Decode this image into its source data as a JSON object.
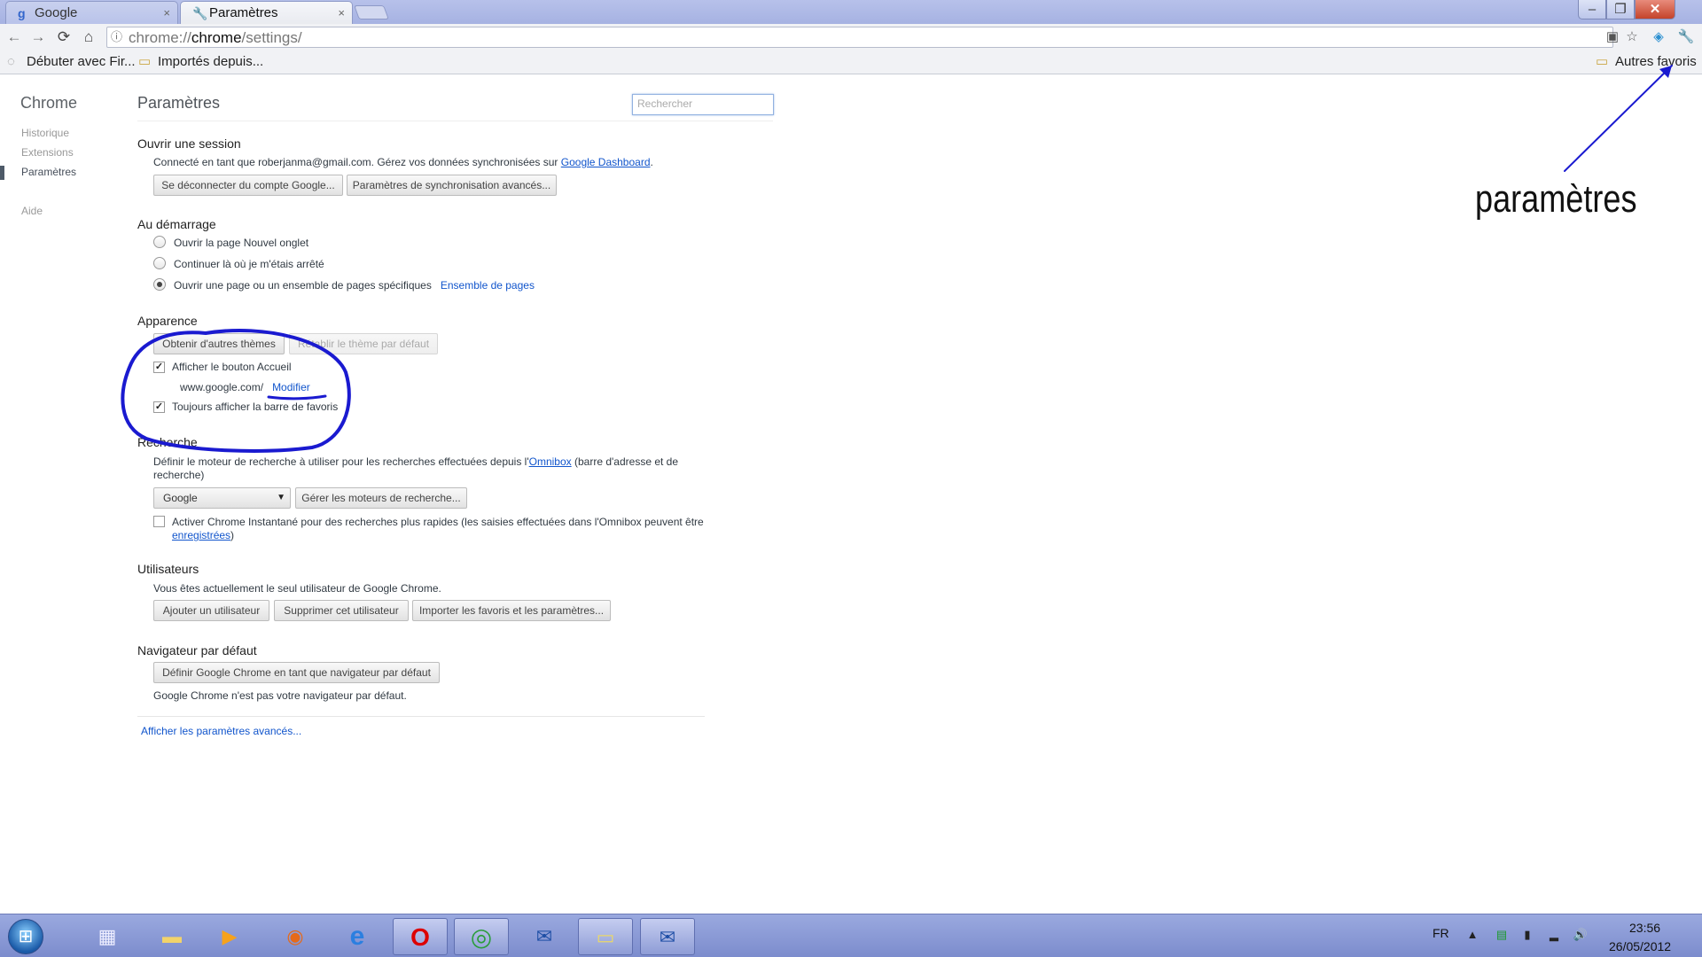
{
  "browser": {
    "tabs": [
      {
        "label": "Google",
        "favicon": "google-g-icon"
      },
      {
        "label": "Paramètres",
        "favicon": "wrench-icon"
      }
    ],
    "omnibox": {
      "scheme": "chrome://",
      "host": "chrome",
      "path": "/settings/"
    },
    "bookmarks": [
      {
        "label": "Débuter avec Fir...",
        "icon": "page-icon"
      },
      {
        "label": "Importés depuis...",
        "icon": "folder-icon"
      }
    ],
    "other_bookmarks": "Autres favoris"
  },
  "sidebar": {
    "title": "Chrome",
    "items": [
      {
        "label": "Historique"
      },
      {
        "label": "Extensions"
      },
      {
        "label": "Paramètres"
      },
      {
        "label": "Aide"
      }
    ]
  },
  "settings": {
    "title": "Paramètres",
    "search_placeholder": "Rechercher",
    "session": {
      "title": "Ouvrir une session",
      "text": "Connecté en tant que roberjanma@gmail.com. Gérez vos données synchronisées sur",
      "dashboard_link": "Google Dashboard",
      "period": ".",
      "disconnect_button": "Se déconnecter du compte Google...",
      "sync_button": "Paramètres de synchronisation avancés..."
    },
    "startup": {
      "title": "Au démarrage",
      "options": [
        "Ouvrir la page Nouvel onglet",
        "Continuer là où je m'étais arrêté",
        "Ouvrir une page ou un ensemble de pages spécifiques"
      ],
      "selected_index": 2,
      "pages_link": "Ensemble de pages"
    },
    "appearance": {
      "title": "Apparence",
      "themes_button": "Obtenir d'autres thèmes",
      "reset_theme_button": "Rétablir le thème par défaut",
      "home_button_label": "Afficher le bouton Accueil",
      "home_url": "www.google.com/",
      "modify_link": "Modifier",
      "bookmarks_bar_label": "Toujours afficher la barre de favoris"
    },
    "search": {
      "title": "Recherche",
      "text_before": "Définir le moteur de recherche à utiliser pour les recherches effectuées depuis l'",
      "omnibox_link": "Omnibox",
      "text_after": " (barre d'adresse et de",
      "text_line2": "recherche)",
      "engine_selected": "Google",
      "manage_button": "Gérer les moteurs de recherche...",
      "instant_text": "Activer Chrome Instantané pour des recherches plus rapides (les saisies effectuées dans l'Omnibox peuvent être",
      "instant_link": "enregistrées",
      "instant_close": ")"
    },
    "users": {
      "title": "Utilisateurs",
      "text": "Vous êtes actuellement le seul utilisateur de Google Chrome.",
      "add_button": "Ajouter un utilisateur",
      "delete_button": "Supprimer cet utilisateur",
      "import_button": "Importer les favoris et les paramètres..."
    },
    "default_browser": {
      "title": "Navigateur par défaut",
      "set_default_button": "Définir Google Chrome en tant que navigateur par défaut",
      "status": "Google Chrome n'est pas votre navigateur par défaut."
    },
    "advanced_link": "Afficher les paramètres avancés..."
  },
  "annotation": {
    "label": "paramètres",
    "color": "#1a1ad0"
  },
  "taskbar": {
    "apps": [
      {
        "name": "calculator",
        "glyph": "▦"
      },
      {
        "name": "file-explorer",
        "glyph": "▬"
      },
      {
        "name": "media-player",
        "glyph": "▶"
      },
      {
        "name": "firefox",
        "glyph": "◉"
      },
      {
        "name": "internet-explorer",
        "glyph": "e"
      },
      {
        "name": "opera",
        "glyph": "O"
      },
      {
        "name": "chrome",
        "glyph": "◎"
      },
      {
        "name": "thunderbird",
        "glyph": "✉"
      },
      {
        "name": "sticky-notes",
        "glyph": "▭"
      },
      {
        "name": "thunderbird-2",
        "glyph": "✉"
      }
    ],
    "language": "FR",
    "time": "23:56",
    "date": "26/05/2012"
  }
}
